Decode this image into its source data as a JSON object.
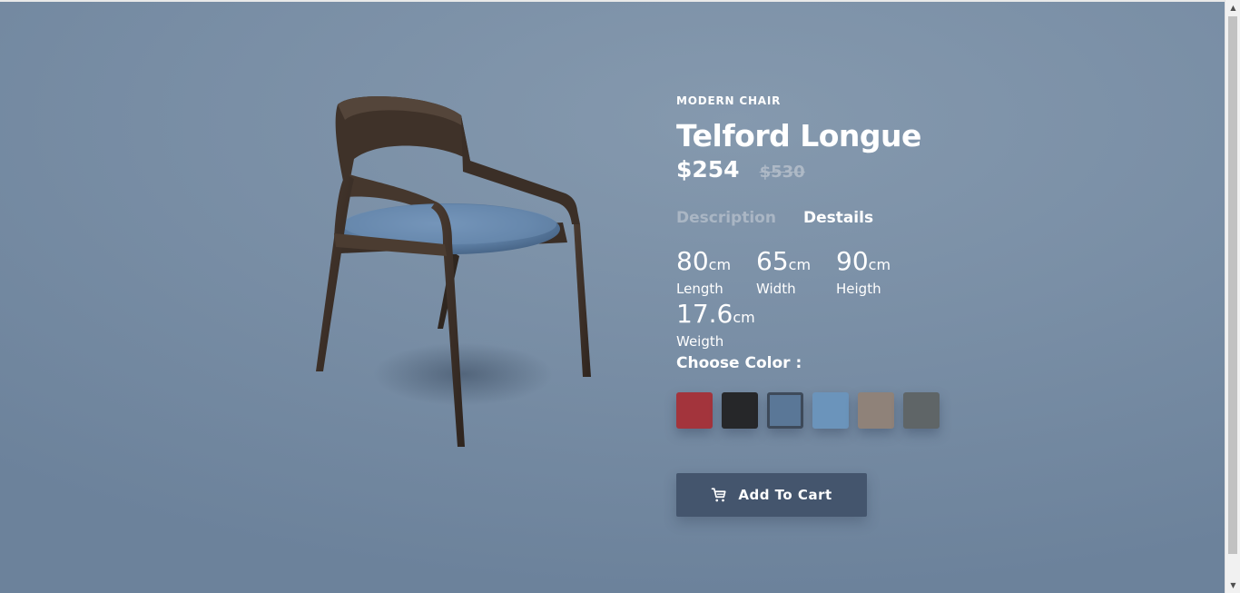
{
  "product": {
    "category": "MODERN CHAIR",
    "name": "Telford Longue",
    "price": "$254",
    "old_price": "$530"
  },
  "tabs": [
    {
      "label": "Description",
      "active": false
    },
    {
      "label": "Destails",
      "active": true
    }
  ],
  "dimensions": [
    {
      "value": "80",
      "unit": "cm",
      "label": "Length"
    },
    {
      "value": "65",
      "unit": "cm",
      "label": "Width"
    },
    {
      "value": "90",
      "unit": "cm",
      "label": "Heigth"
    },
    {
      "value": "17.6",
      "unit": "cm",
      "label": "Weigth"
    }
  ],
  "color_section": {
    "label": "Choose Color :",
    "swatches": [
      {
        "name": "red",
        "color": "#a3343c",
        "selected": false
      },
      {
        "name": "black",
        "color": "#262729",
        "selected": false
      },
      {
        "name": "denim-blue",
        "color": "#5a7797",
        "selected": true
      },
      {
        "name": "light-blue",
        "color": "#6b94bb",
        "selected": false
      },
      {
        "name": "taupe",
        "color": "#8f8279",
        "selected": false
      },
      {
        "name": "grey",
        "color": "#5f6567",
        "selected": false
      }
    ]
  },
  "cart": {
    "label": "Add To Cart",
    "icon": "cart-icon"
  },
  "colors": {
    "background": "#7a8fa6",
    "button": "#44556d",
    "text": "#ffffff",
    "muted_text": "#aab6c4"
  }
}
